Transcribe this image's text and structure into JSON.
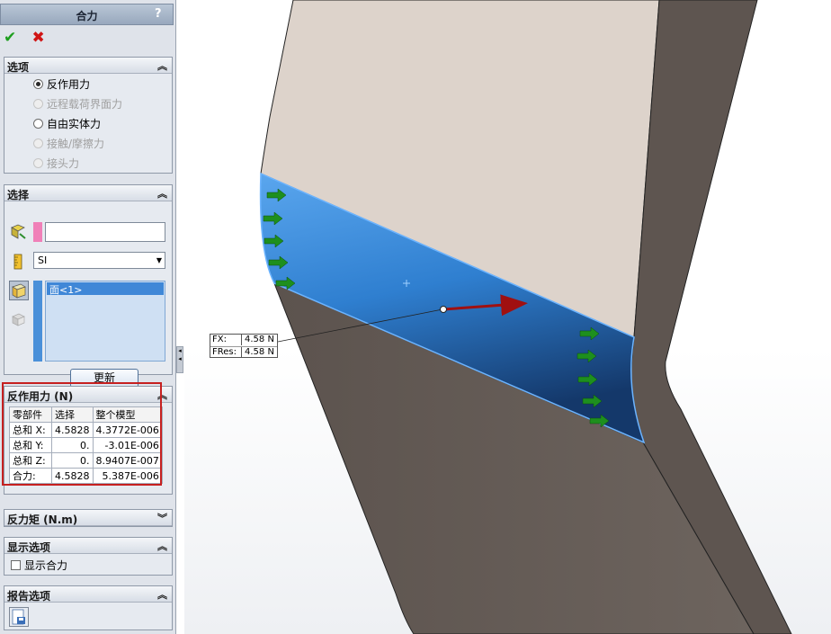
{
  "panel": {
    "title": "合力",
    "help": "?",
    "ok_symbol": "✔",
    "cancel_symbol": "✖"
  },
  "options": {
    "header": "选项",
    "radios": [
      {
        "label": "反作用力",
        "checked": true,
        "enabled": true
      },
      {
        "label": "远程载荷界面力",
        "checked": false,
        "enabled": false
      },
      {
        "label": "自由实体力",
        "checked": false,
        "enabled": true
      },
      {
        "label": "接触/摩擦力",
        "checked": false,
        "enabled": false
      },
      {
        "label": "接头力",
        "checked": false,
        "enabled": false
      }
    ]
  },
  "selection": {
    "header": "选择",
    "entity_value": "",
    "unit": "SI",
    "face_item": "面<1>",
    "update_label": "更新"
  },
  "reaction": {
    "header": "反作用力 (N)",
    "columns": [
      "零部件",
      "选择",
      "整个模型"
    ],
    "rows": [
      [
        "总和 X:",
        "4.5828",
        "4.3772E-006"
      ],
      [
        "总和 Y:",
        "0.",
        "-3.01E-006"
      ],
      [
        "总和 Z:",
        "0.",
        "8.9407E-007"
      ],
      [
        "合力:",
        "4.5828",
        "5.387E-006"
      ]
    ]
  },
  "moment": {
    "header": "反力矩 (N.m)"
  },
  "display": {
    "header": "显示选项",
    "show_resultant": "显示合力",
    "checked": false
  },
  "report": {
    "header": "报告选项"
  },
  "callout": {
    "fx_label": "FX:",
    "fx_value": "4.58 N",
    "fres_label": "FRes:",
    "fres_value": "4.58 N"
  },
  "colors": {
    "selected_face": "#2f7fd0",
    "part_top": "#ddd3cb",
    "part_side": "#6a605a",
    "arrow_green": "#1e8f1e",
    "resultant_arrow": "#a01010"
  }
}
